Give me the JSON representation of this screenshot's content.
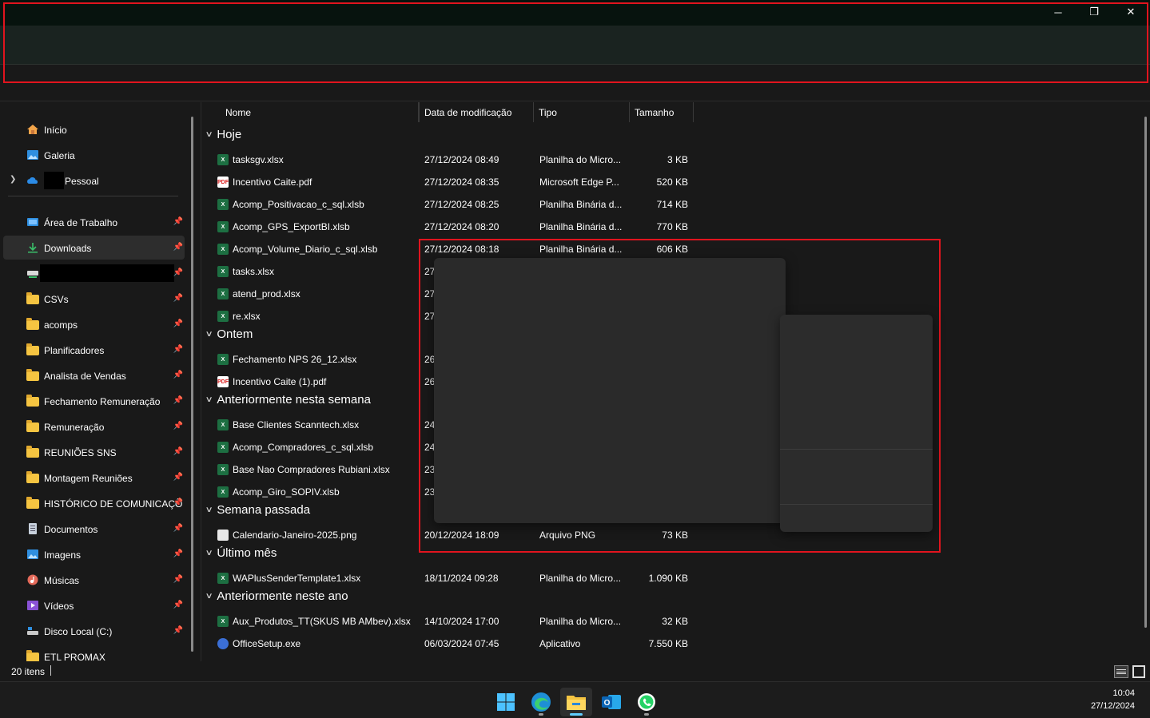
{
  "window": {
    "controls": {
      "minimize": "─",
      "maximize": "❐",
      "close": "✕"
    }
  },
  "sidebar": {
    "top_items": [
      {
        "label": "Início",
        "icon": "home-icon"
      },
      {
        "label": "Galeria",
        "icon": "gallery-icon"
      },
      {
        "label": "Pessoal",
        "icon": "onedrive-cloud-icon"
      }
    ],
    "pinned_items": [
      {
        "label": "Área de Trabalho",
        "icon": "desktop-icon"
      },
      {
        "label": "Downloads",
        "icon": "download-icon",
        "selected": true
      },
      {
        "label": "",
        "icon": "network-drive-icon"
      },
      {
        "label": "CSVs",
        "icon": "folder-icon"
      },
      {
        "label": "acomps",
        "icon": "folder-icon"
      },
      {
        "label": "Planificadores",
        "icon": "folder-icon"
      },
      {
        "label": "Analista de Vendas",
        "icon": "folder-icon"
      },
      {
        "label": "Fechamento Remuneração",
        "icon": "folder-icon"
      },
      {
        "label": "Remuneração",
        "icon": "folder-icon"
      },
      {
        "label": "REUNIÕES SNS",
        "icon": "folder-icon"
      },
      {
        "label": "Montagem Reuniões",
        "icon": "folder-icon"
      },
      {
        "label": "HISTÓRICO DE COMUNICAÇÕ",
        "icon": "folder-icon"
      },
      {
        "label": "Documentos",
        "icon": "documents-icon"
      },
      {
        "label": "Imagens",
        "icon": "pictures-icon"
      },
      {
        "label": "Músicas",
        "icon": "music-icon"
      },
      {
        "label": "Vídeos",
        "icon": "videos-icon"
      },
      {
        "label": "Disco Local (C:)",
        "icon": "drive-icon"
      },
      {
        "label": "ETL PROMAX",
        "icon": "folder-icon"
      }
    ]
  },
  "columns": {
    "name": "Nome",
    "date": "Data de modificação",
    "type": "Tipo",
    "size": "Tamanho"
  },
  "groups": [
    {
      "title": "Hoje",
      "files": [
        {
          "name": "tasksgv.xlsx",
          "kind": "xls",
          "date": "27/12/2024 08:49",
          "type": "Planilha do Micro...",
          "size": "3 KB"
        },
        {
          "name": "Incentivo Caite.pdf",
          "kind": "pdf",
          "date": "27/12/2024 08:35",
          "type": "Microsoft Edge P...",
          "size": "520 KB"
        },
        {
          "name": "Acomp_Positivacao_c_sql.xlsb",
          "kind": "xls",
          "date": "27/12/2024 08:25",
          "type": "Planilha Binária d...",
          "size": "714 KB"
        },
        {
          "name": "Acomp_GPS_ExportBI.xlsb",
          "kind": "xls",
          "date": "27/12/2024 08:20",
          "type": "Planilha Binária d...",
          "size": "770 KB"
        },
        {
          "name": "Acomp_Volume_Diario_c_sql.xlsb",
          "kind": "xls",
          "date": "27/12/2024 08:18",
          "type": "Planilha Binária d...",
          "size": "606 KB"
        },
        {
          "name": "tasks.xlsx",
          "kind": "xls",
          "date": "27,",
          "type": "",
          "size": ""
        },
        {
          "name": "atend_prod.xlsx",
          "kind": "xls",
          "date": "27,",
          "type": "",
          "size": ""
        },
        {
          "name": "re.xlsx",
          "kind": "xls",
          "date": "27,",
          "type": "",
          "size": ""
        }
      ]
    },
    {
      "title": "Ontem",
      "files": [
        {
          "name": "Fechamento NPS 26_12.xlsx",
          "kind": "xls",
          "date": "26,",
          "type": "",
          "size": ""
        },
        {
          "name": "Incentivo Caite (1).pdf",
          "kind": "pdf",
          "date": "26,",
          "type": "",
          "size": ""
        }
      ]
    },
    {
      "title": "Anteriormente nesta semana",
      "files": [
        {
          "name": "Base Clientes Scanntech.xlsx",
          "kind": "xls",
          "date": "24,",
          "type": "",
          "size": ""
        },
        {
          "name": "Acomp_Compradores_c_sql.xlsb",
          "kind": "xls",
          "date": "24,",
          "type": "",
          "size": ""
        },
        {
          "name": "Base Nao Compradores Rubiani.xlsx",
          "kind": "xls",
          "date": "23,",
          "type": "",
          "size": ""
        },
        {
          "name": "Acomp_Giro_SOPIV.xlsb",
          "kind": "xls",
          "date": "23,",
          "type": "",
          "size": ""
        }
      ]
    },
    {
      "title": "Semana passada",
      "files": [
        {
          "name": "Calendario-Janeiro-2025.png",
          "kind": "png",
          "date": "20/12/2024 18:09",
          "type": "Arquivo PNG",
          "size": "73 KB"
        }
      ]
    },
    {
      "title": "Último mês",
      "files": [
        {
          "name": "WAPlusSenderTemplate1.xlsx",
          "kind": "xls",
          "date": "18/11/2024 09:28",
          "type": "Planilha do Micro...",
          "size": "1.090 KB"
        }
      ]
    },
    {
      "title": "Anteriormente neste ano",
      "files": [
        {
          "name": "Aux_Produtos_TT(SKUS MB AMbev).xlsx",
          "kind": "xls",
          "date": "14/10/2024 17:00",
          "type": "Planilha do Micro...",
          "size": "32 KB"
        },
        {
          "name": "OfficeSetup.exe",
          "kind": "exe",
          "date": "06/03/2024 07:45",
          "type": "Aplicativo",
          "size": "7.550 KB"
        }
      ]
    }
  ],
  "status": {
    "count": "20 itens"
  },
  "taskbar": {
    "apps": [
      "windows-start-icon",
      "edge-icon",
      "file-explorer-icon",
      "outlook-icon",
      "whatsapp-icon"
    ],
    "time": "10:04",
    "date": "27/12/2024"
  },
  "colors": {
    "highlight_red": "#e1141e",
    "accent": "#60cdff",
    "excel_green": "#1d6f42"
  }
}
